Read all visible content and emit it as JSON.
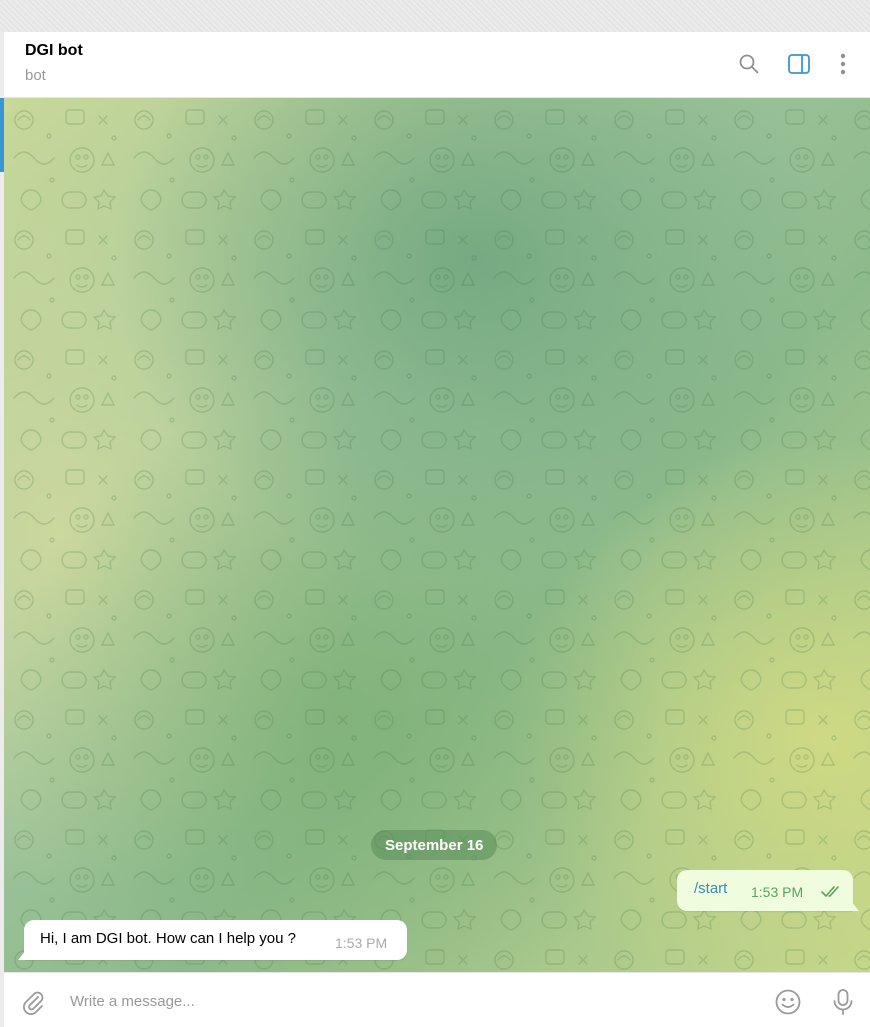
{
  "header": {
    "title": "DGI bot",
    "status": "bot"
  },
  "chat": {
    "date_separator": "September 16",
    "messages": [
      {
        "direction": "outgoing",
        "text": "/start",
        "time": "1:53 PM",
        "read": true
      },
      {
        "direction": "incoming",
        "text": "Hi, I am DGI bot. How can I help you ?",
        "time": "1:53 PM"
      }
    ]
  },
  "composer": {
    "placeholder": "Write a message..."
  },
  "icons": {
    "search": "search-icon",
    "sidebar": "sidebar-toggle-icon",
    "more": "more-vertical-icon",
    "attach": "paperclip-icon",
    "emoji": "emoji-icon",
    "mic": "microphone-icon",
    "read": "double-check-icon"
  },
  "colors": {
    "accent": "#3a95d5",
    "outgoing_bubble": "#effdde",
    "incoming_bubble": "#ffffff",
    "icon_gray": "#9a9a9a"
  }
}
